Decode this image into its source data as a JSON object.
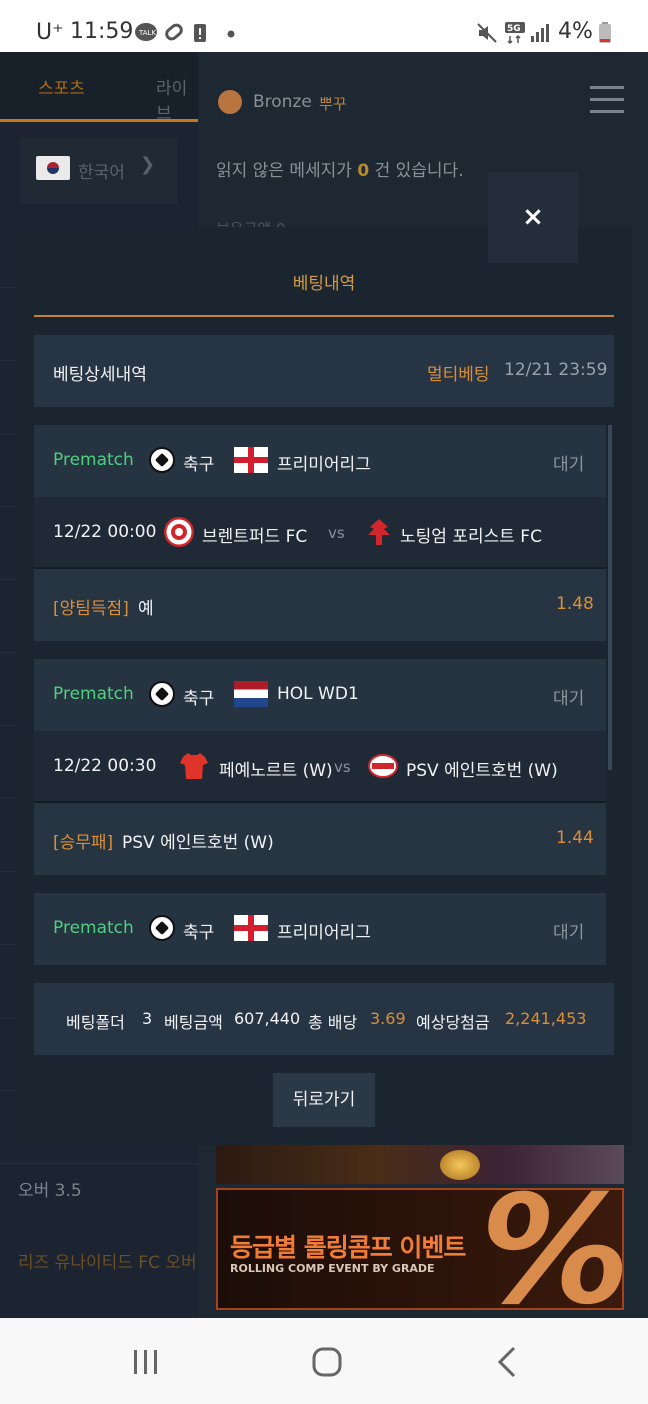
{
  "status_bar": {
    "carrier": "U⁺",
    "time": "11:59",
    "battery": "4%",
    "icons": [
      "talk-icon",
      "link-icon",
      "battery-alert-icon",
      "dot-icon",
      "mute-icon",
      "5g-icon",
      "signal-icon",
      "battery-icon"
    ]
  },
  "background": {
    "tabs": [
      "스포츠",
      "라이브"
    ],
    "language": "한국어",
    "rank": "Bronze",
    "nickname": "뿌꾸",
    "message_prefix": "읽지 않은 메세지가",
    "message_count": "0",
    "message_suffix": "건 있습니다.",
    "partial_line": "보유금액",
    "partial_value": "0",
    "list_item_1": "오버 3.5",
    "list_item_2": "리즈 유나이티드 FC 오버",
    "promo_title": "등급별 롤링콤프 이벤트",
    "promo_subtitle": "ROLLING COMP EVENT BY GRADE",
    "promo_symbol": "%"
  },
  "modal": {
    "close_label": "×",
    "title": "베팅내역",
    "detail_label": "베팅상세내역",
    "bet_type": "멀티베팅",
    "bet_datetime": "12/21 23:59",
    "bets": [
      {
        "phase": "Prematch",
        "sport": "축구",
        "league": "프리미어리그",
        "state": "대기",
        "match_time": "12/22 00:00",
        "home": "브렌트퍼드 FC",
        "vs": "vs",
        "away": "노팅엄 포리스트 FC",
        "market": "[양팀득점]",
        "selection": "예",
        "odds": "1.48"
      },
      {
        "phase": "Prematch",
        "sport": "축구",
        "league": "HOL WD1",
        "state": "대기",
        "match_time": "12/22 00:30",
        "home": "페예노르트 (W)",
        "vs": "vs",
        "away": "PSV 에인트호번 (W)",
        "market": "[승무패]",
        "selection": "PSV 에인트호번 (W)",
        "odds": "1.44"
      },
      {
        "phase": "Prematch",
        "sport": "축구",
        "league": "프리미어리그",
        "state": "대기"
      }
    ],
    "summary": {
      "folder_label": "베팅폴더",
      "folder_count": "3",
      "amount_label": "베팅금액",
      "amount": "607,440",
      "odds_label": "총 배당",
      "total_odds": "3.69",
      "payout_label": "예상당첨금",
      "payout": "2,241,453"
    },
    "back_label": "뒤로가기"
  },
  "colors": {
    "accent": "#d88f39",
    "prematch": "#4fd07f",
    "panel": "#273443",
    "modal_bg": "#1b2530"
  }
}
